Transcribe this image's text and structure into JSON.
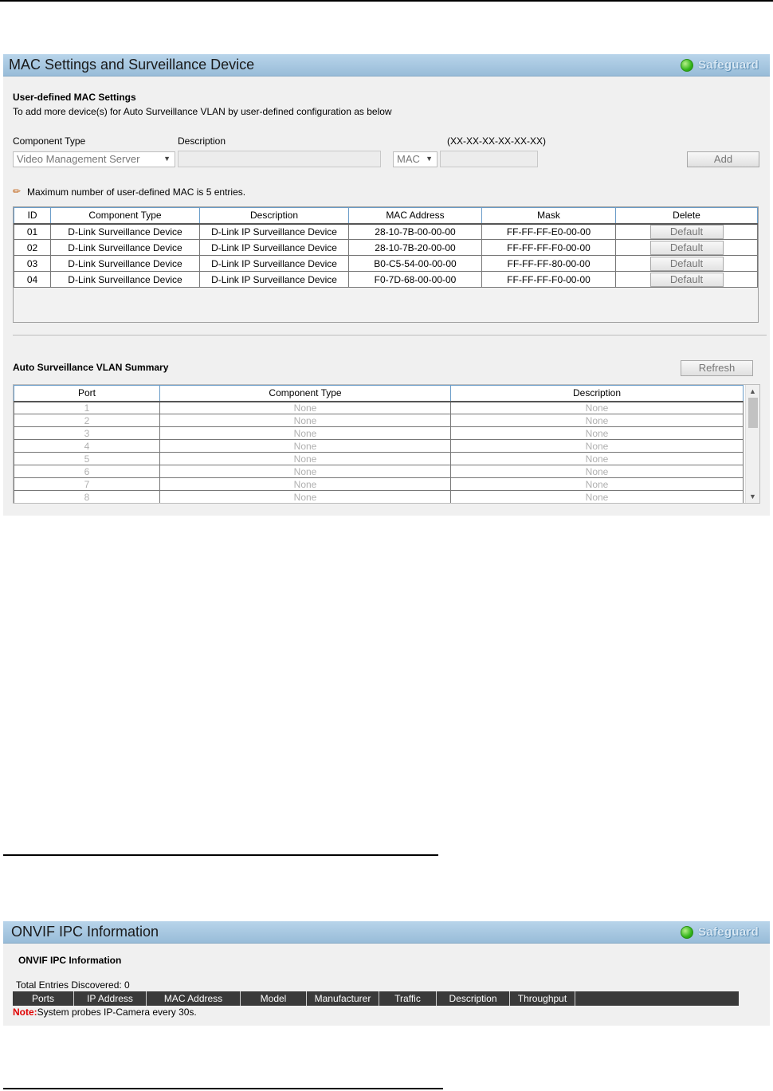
{
  "mac_panel": {
    "title": "MAC Settings and Surveillance Device",
    "status_label": "Safeguard",
    "section_title": "User-defined MAC Settings",
    "section_desc": "To add more device(s) for Auto Surveillance VLAN by user-defined configuration as below",
    "component_type_label": "Component Type",
    "description_label": "Description",
    "mac_format_hint": "(XX-XX-XX-XX-XX-XX)",
    "component_type_value": "Video Management Server",
    "address_type_value": "MAC",
    "add_button": "Add",
    "max_note": "Maximum number of user-defined MAC is 5 entries.",
    "table_headers": [
      "ID",
      "Component Type",
      "Description",
      "MAC Address",
      "Mask",
      "Delete"
    ],
    "rows": [
      {
        "id": "01",
        "component": "D-Link Surveillance Device",
        "description": "D-Link IP Surveillance Device",
        "mac": "28-10-7B-00-00-00",
        "mask": "FF-FF-FF-E0-00-00",
        "action": "Default"
      },
      {
        "id": "02",
        "component": "D-Link Surveillance Device",
        "description": "D-Link IP Surveillance Device",
        "mac": "28-10-7B-20-00-00",
        "mask": "FF-FF-FF-F0-00-00",
        "action": "Default"
      },
      {
        "id": "03",
        "component": "D-Link Surveillance Device",
        "description": "D-Link IP Surveillance Device",
        "mac": "B0-C5-54-00-00-00",
        "mask": "FF-FF-FF-80-00-00",
        "action": "Default"
      },
      {
        "id": "04",
        "component": "D-Link Surveillance Device",
        "description": "D-Link IP Surveillance Device",
        "mac": "F0-7D-68-00-00-00",
        "mask": "FF-FF-FF-F0-00-00",
        "action": "Default"
      }
    ],
    "summary_title": "Auto Surveillance VLAN Summary",
    "refresh_button": "Refresh",
    "summary_headers": [
      "Port",
      "Component Type",
      "Description"
    ],
    "summary_rows": [
      {
        "port": "1",
        "component": "None",
        "description": "None"
      },
      {
        "port": "2",
        "component": "None",
        "description": "None"
      },
      {
        "port": "3",
        "component": "None",
        "description": "None"
      },
      {
        "port": "4",
        "component": "None",
        "description": "None"
      },
      {
        "port": "5",
        "component": "None",
        "description": "None"
      },
      {
        "port": "6",
        "component": "None",
        "description": "None"
      },
      {
        "port": "7",
        "component": "None",
        "description": "None"
      },
      {
        "port": "8",
        "component": "None",
        "description": "None"
      }
    ]
  },
  "onvif_panel": {
    "title": "ONVIF IPC Information",
    "status_label": "Safeguard",
    "section_title": "ONVIF IPC Information",
    "total_entries": "Total Entries Discovered: 0",
    "columns": [
      "Ports",
      "IP Address",
      "MAC Address",
      "Model",
      "Manufacturer",
      "Traffic",
      "Description",
      "Throughput"
    ],
    "note_prefix": "Note:",
    "note_text": "System probes IP-Camera every 30s."
  },
  "colors": {
    "header_gradient_top": "#b8d4ea",
    "header_gradient_bottom": "#98bcd8",
    "status_led": "#33b51a",
    "note_red": "#e00000",
    "onvif_bar": "#3a3a3a"
  },
  "icons": {
    "status": "green-led-icon",
    "note": "pencil-icon",
    "dropdown": "chevron-down-icon"
  }
}
